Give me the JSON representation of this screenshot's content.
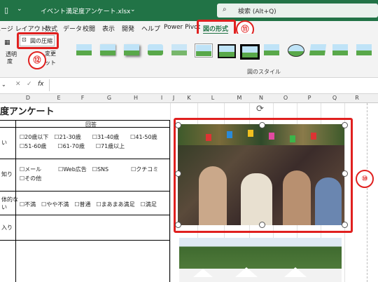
{
  "titlebar": {
    "filename": "イベント満足度アンケート.xlsx",
    "search_placeholder": "検索 (Alt+Q)"
  },
  "ribbon_tabs": [
    "ページ レイアウト",
    "数式",
    "データ",
    "校閲",
    "表示",
    "開発",
    "ヘルプ",
    "Power Pivot",
    "図の形式"
  ],
  "ribbon": {
    "compress_label": "図の圧縮",
    "transparency_label_1": "透明",
    "transparency_label_2": "度",
    "change_label": "変更",
    "reset_label": "ット",
    "styles_group_label": "図のスタイル"
  },
  "formula_bar": {
    "fx": "fx"
  },
  "columns": [
    "D",
    "E",
    "F",
    "G",
    "H",
    "I",
    "J",
    "K",
    "L",
    "M",
    "N",
    "O",
    "P",
    "Q",
    "R"
  ],
  "sheet": {
    "title": "度アンケート",
    "answer_header": "回答",
    "rows": [
      {
        "label": "い",
        "line1": "☐20歳以下　☐21-30歳　　☐31-40歳　　☐41-50歳",
        "line2": "☐51-60歳　　☐61-70歳　　☐71歳以上"
      },
      {
        "label": "知り",
        "line1": "☐メール　　　☐Web広告　☐SNS　　　　☐クチコミ",
        "line2": "☐その他"
      },
      {
        "label1": "体的な",
        "label2": "い",
        "line1": "☐不満　☐やや不満　☐普通　☐まあまあ満足　☐満足"
      },
      {
        "label": "入り"
      }
    ]
  },
  "callouts": {
    "c10": "⑩",
    "c11": "⑪",
    "c12": "⑫"
  },
  "colors": {
    "excel_green": "#217346",
    "callout_red": "#e0201f"
  }
}
